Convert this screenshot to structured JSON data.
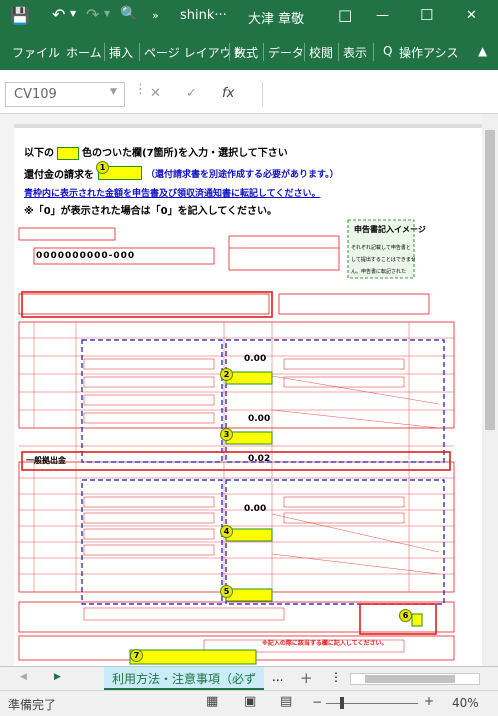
{
  "window": {
    "title": "shink···",
    "user": "大津 章敬",
    "ribbon_display_glyph": "□",
    "minimize_glyph": "—",
    "maximize_glyph": "☐",
    "close_glyph": "✕",
    "accent": "#217346"
  },
  "ribbon": {
    "tabs": [
      "ファイル",
      "ホーム",
      "挿入",
      "ページ レイアウト",
      "数式",
      "データ",
      "校閲",
      "表示"
    ],
    "tell_me": "操作アシス",
    "tell_me_glyph": "Q"
  },
  "formula_bar": {
    "name_box": "CV109",
    "cancel_glyph": "✕",
    "enter_glyph": "✓",
    "fx_glyph": "fx"
  },
  "sheet": {
    "instruction_1_prefix": "以下の",
    "instruction_1_suffix": "色のついた欄(7箇所)を入力・選択して下さい",
    "instruction_2_prefix": "還付金の請求を",
    "instruction_2_note": "（還付請求書を別途作成する必要があります。）",
    "instruction_3": "青枠内に表示された金額を申告書及び領収済通知書に転記してください。",
    "instruction_4": "※「0」が表示された場合は「0」を記入してください。",
    "callout_title": "申告書記入イメージ",
    "callout_lines": [
      "それぞれ記載して申告書と",
      "して提出することはできませ",
      "ん。申告書に転記された"
    ],
    "section_a_label": "一般拠出金",
    "value_1": "0.00",
    "value_2": "0.00",
    "value_3": "0.02",
    "value_4": "0.00",
    "circled_numbers": [
      "1",
      "2",
      "3",
      "4",
      "5",
      "6",
      "7"
    ],
    "red_note": "※記入の際に該当する欄に記入してください。"
  },
  "sheet_tabs": {
    "active_tab": "利用方法・注意事項（必ず",
    "more": "...",
    "add_glyph": "+",
    "prev_glyph": "◀",
    "next_glyph": "▶"
  },
  "status": {
    "ready": "準備完了",
    "zoom_minus": "−",
    "zoom_plus": "+",
    "zoom": "40%"
  }
}
